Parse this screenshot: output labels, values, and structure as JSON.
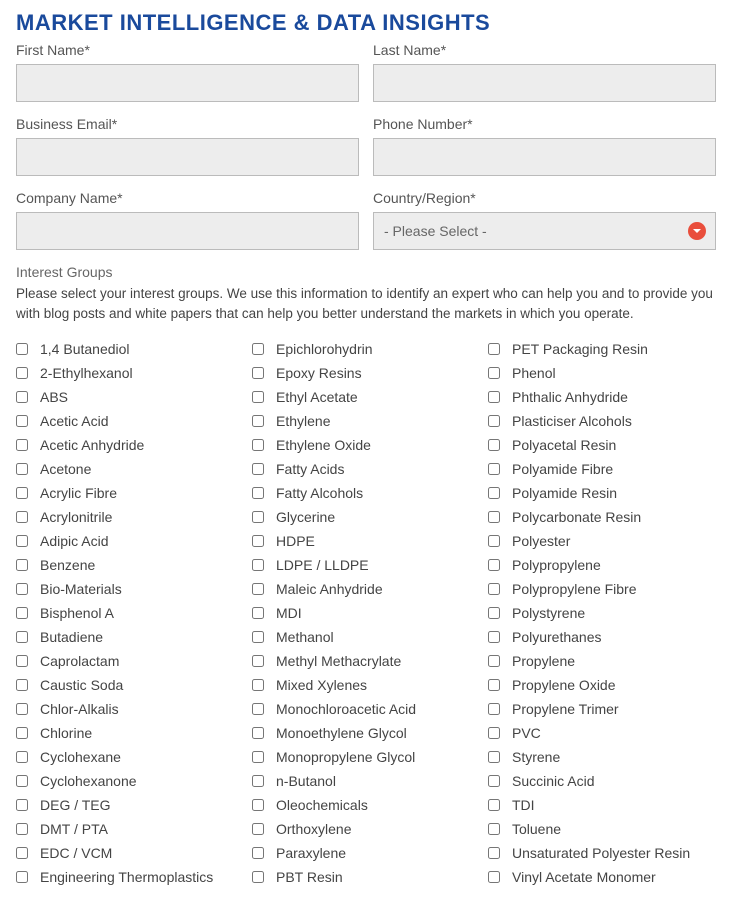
{
  "title": "MARKET INTELLIGENCE & DATA INSIGHTS",
  "fields": {
    "first_name": {
      "label": "First Name*"
    },
    "last_name": {
      "label": "Last Name*"
    },
    "business_email": {
      "label": "Business Email*"
    },
    "phone": {
      "label": "Phone Number*"
    },
    "company": {
      "label": "Company Name*"
    },
    "country": {
      "label": "Country/Region*",
      "placeholder": "- Please Select -"
    }
  },
  "interest": {
    "label": "Interest Groups",
    "helper": "Please select your interest groups. We use this information to identify an expert who can help you and to provide you with blog posts and white papers that can help you better understand the markets in which you operate."
  },
  "checkbox_columns": [
    [
      "1,4 Butanediol",
      "2-Ethylhexanol",
      "ABS",
      "Acetic Acid",
      "Acetic Anhydride",
      "Acetone",
      "Acrylic Fibre",
      "Acrylonitrile",
      "Adipic Acid",
      "Benzene",
      "Bio-Materials",
      "Bisphenol A",
      "Butadiene",
      "Caprolactam",
      "Caustic Soda",
      "Chlor-Alkalis",
      "Chlorine",
      "Cyclohexane",
      "Cyclohexanone",
      "DEG / TEG",
      "DMT / PTA",
      "EDC / VCM",
      "Engineering Thermoplastics"
    ],
    [
      "Epichlorohydrin",
      "Epoxy Resins",
      "Ethyl Acetate",
      "Ethylene",
      "Ethylene Oxide",
      "Fatty Acids",
      "Fatty Alcohols",
      "Glycerine",
      "HDPE",
      "LDPE / LLDPE",
      "Maleic Anhydride",
      "MDI",
      "Methanol",
      "Methyl Methacrylate",
      "Mixed Xylenes",
      "Monochloroacetic Acid",
      "Monoethylene Glycol",
      "Monopropylene Glycol",
      "n-Butanol",
      "Oleochemicals",
      "Orthoxylene",
      "Paraxylene",
      "PBT Resin"
    ],
    [
      "PET Packaging Resin",
      "Phenol",
      "Phthalic Anhydride",
      "Plasticiser Alcohols",
      "Polyacetal Resin",
      "Polyamide Fibre",
      "Polyamide Resin",
      "Polycarbonate Resin",
      "Polyester",
      "Polypropylene",
      "Polypropylene Fibre",
      "Polystyrene",
      "Polyurethanes",
      "Propylene",
      "Propylene Oxide",
      "Propylene Trimer",
      "PVC",
      "Styrene",
      "Succinic Acid",
      "TDI",
      "Toluene",
      "Unsaturated Polyester Resin",
      "Vinyl Acetate Monomer"
    ]
  ]
}
